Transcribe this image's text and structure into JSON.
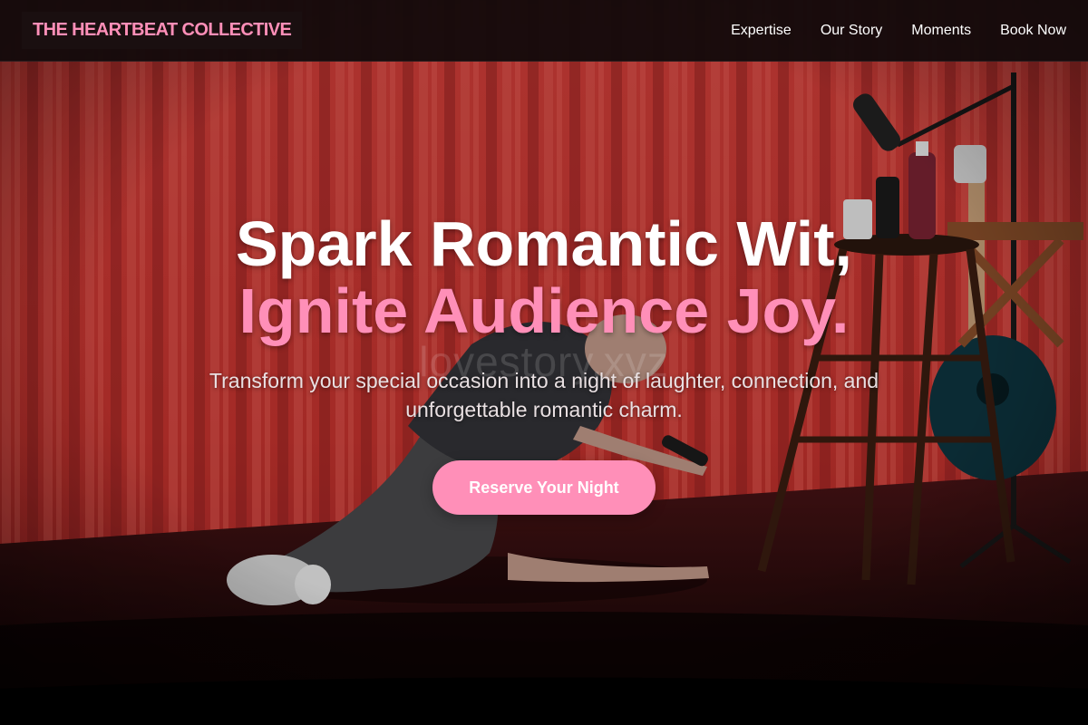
{
  "header": {
    "brand": "THE HEARTBEAT COLLECTIVE",
    "nav": [
      {
        "label": "Expertise"
      },
      {
        "label": "Our Story"
      },
      {
        "label": "Moments"
      },
      {
        "label": "Book Now"
      }
    ]
  },
  "hero": {
    "headline_line1": "Spark Romantic Wit,",
    "headline_line2": "Ignite Audience Joy.",
    "subtitle": "Transform your special occasion into a night of laughter, connection, and unforgettable romantic charm.",
    "watermark": "lovestory.xyz",
    "cta_label": "Reserve Your Night",
    "background_image": "comedian-on-stage-red-curtain"
  },
  "colors": {
    "accent_pink": "#ff8fb8",
    "nav_background": "#140a0b",
    "curtain_red": "#c93a36",
    "text_white": "#ffffff"
  }
}
